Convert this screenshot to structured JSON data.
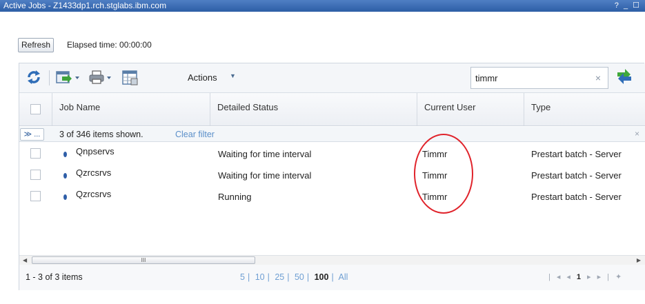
{
  "window": {
    "title": "Active Jobs - Z1433dp1.rch.stglabs.ibm.com",
    "controls": "? _ ☐"
  },
  "top": {
    "refresh_label": "Refresh",
    "elapsed": "Elapsed time: 00:00:00"
  },
  "toolbar": {
    "actions_label": "Actions",
    "search_value": "timmr",
    "clear_glyph": "×"
  },
  "columns": [
    "Job Name",
    "Detailed Status",
    "Current User",
    "Type"
  ],
  "filter": {
    "button_label": "≫ ...",
    "summary": "3 of 346 items shown.",
    "clear_label": "Clear filter",
    "close_glyph": "×"
  },
  "rows": [
    {
      "job": "Qnpservs",
      "status": "Waiting for time interval",
      "user": "Timmr",
      "type": "Prestart batch - Server"
    },
    {
      "job": "Qzrcsrvs",
      "status": "Waiting for time interval",
      "user": "Timmr",
      "type": "Prestart batch - Server"
    },
    {
      "job": "Qzrcsrvs",
      "status": "Running",
      "user": "Timmr",
      "type": "Prestart batch - Server"
    }
  ],
  "scrollbar": {
    "grip": "III"
  },
  "footer": {
    "count": "1 - 3 of 3 items",
    "page_sizes": [
      "5",
      "10",
      "25",
      "50",
      "100",
      "All"
    ],
    "selected_page_size": "100",
    "current_page": "1"
  },
  "icons": [
    "refresh-icon",
    "export-icon",
    "print-icon",
    "table-settings-icon",
    "search-go-icon",
    "filter-icon",
    "job-status-dot-icon"
  ],
  "colors": {
    "title_bar": "#2d5ea6",
    "link": "#5b8fc9",
    "annotation": "#e0232b"
  }
}
